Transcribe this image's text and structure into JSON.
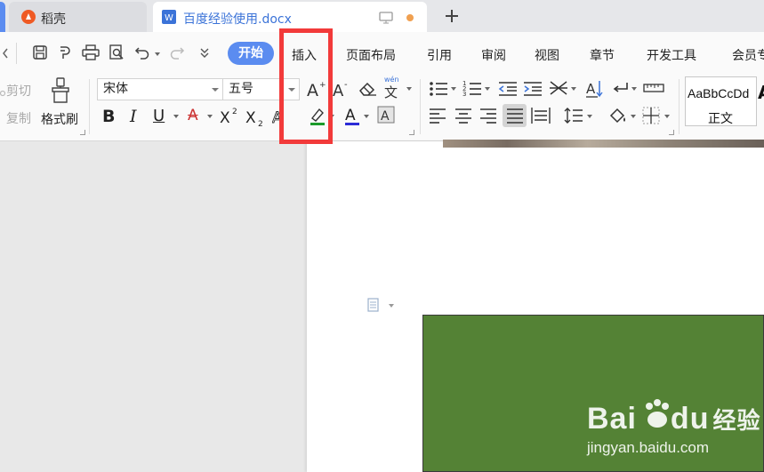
{
  "tabs": [
    {
      "label": "稻壳",
      "icon": "docer-logo-icon"
    },
    {
      "label": "百度经验使用.docx",
      "icon": "wps-writer-icon",
      "active": true
    }
  ],
  "menu": {
    "items": [
      "开始",
      "插入",
      "页面布局",
      "引用",
      "审阅",
      "视图",
      "章节",
      "开发工具",
      "会员专"
    ]
  },
  "ribbon": {
    "cut_label": "剪切",
    "copy_label": "复制",
    "format_painter_label": "格式刷",
    "font_name": "宋体",
    "font_size": "五号",
    "style_preview": "AaBbCcDd",
    "style_name": "正文",
    "pinyin_label": "wén"
  },
  "watermark": {
    "brand": "Bai",
    "brand_suffix": "du",
    "brand_cn": "经验",
    "url": "jingyan.baidu.com"
  },
  "colors": {
    "accent": "#5b8cf0",
    "highlight": "#f23a3a",
    "image_fill": "#548235"
  }
}
